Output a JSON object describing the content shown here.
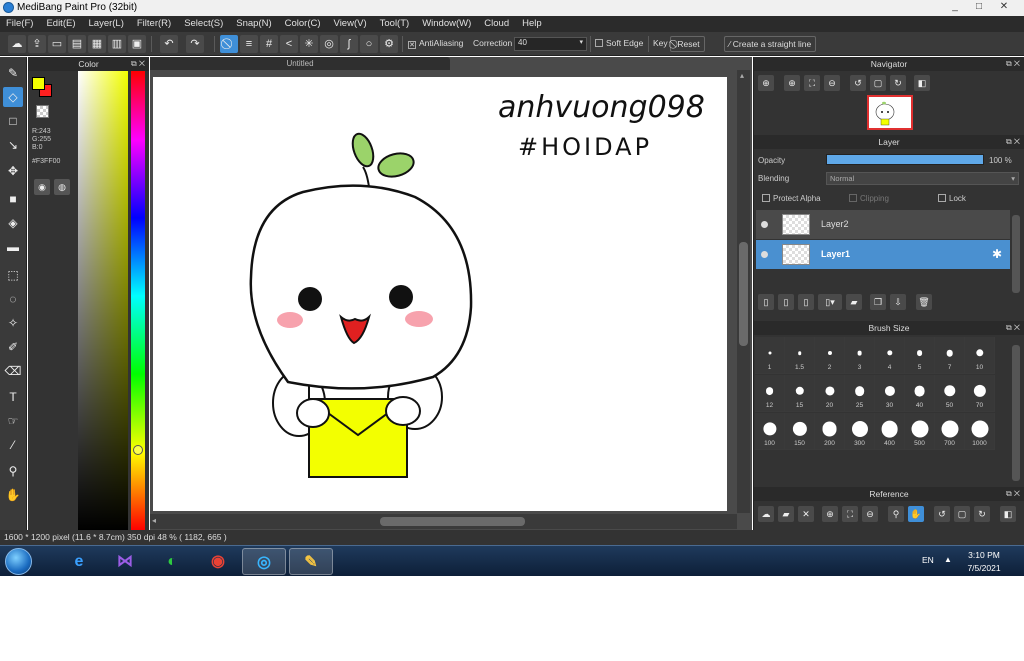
{
  "window": {
    "title": "MediBang Paint Pro (32bit)",
    "minimize": "_",
    "maximize": "□",
    "close": "✕"
  },
  "menu": [
    "File(F)",
    "Edit(E)",
    "Layer(L)",
    "Filter(R)",
    "Select(S)",
    "Snap(N)",
    "Color(C)",
    "View(V)",
    "Tool(T)",
    "Window(W)",
    "Cloud",
    "Help"
  ],
  "toolbar": {
    "antialiasing_label": "AntiAliasing",
    "correction_label": "Correction",
    "correction_value": "40",
    "soft_edge_label": "Soft Edge",
    "key_label": "Key",
    "reset_label": "Reset",
    "straight_line_label": "Create a straight line"
  },
  "color_panel": {
    "title": "Color",
    "foreground": "#F3FF00",
    "background": "#FF2020",
    "r": "R:243",
    "g": "G:255",
    "b": "B:0",
    "hex": "#F3FF00"
  },
  "canvas": {
    "tab_title": "Untitled",
    "handwriting_line1": "anhvuong098",
    "handwriting_line2": "#HOIDAP"
  },
  "navigator": {
    "title": "Navigator"
  },
  "layer_panel": {
    "title": "Layer",
    "opacity_label": "Opacity",
    "opacity_value": "100 %",
    "opacity_fraction": 1.0,
    "blending_label": "Blending",
    "blending_value": "Normal",
    "protect_alpha": "Protect Alpha",
    "clipping": "Clipping",
    "lock": "Lock",
    "layers": [
      {
        "name": "Layer2",
        "selected": false
      },
      {
        "name": "Layer1",
        "selected": true
      }
    ]
  },
  "brush_panel": {
    "title": "Brush Size",
    "sizes": [
      "1",
      "1.5",
      "2",
      "3",
      "4",
      "5",
      "7",
      "10",
      "12",
      "15",
      "20",
      "25",
      "30",
      "40",
      "50",
      "70",
      "100",
      "150",
      "200",
      "300",
      "400",
      "500",
      "700",
      "1000"
    ]
  },
  "reference_panel": {
    "title": "Reference"
  },
  "status": {
    "text": "1600 * 1200 pixel   (11.6 * 8.7cm)   350 dpi   48 %   ( 1182, 665 )"
  },
  "taskbar": {
    "language": "EN",
    "time": "3:10 PM",
    "date": "7/5/2021"
  },
  "colors": {
    "accent": "#3F8FD8",
    "panel": "#333333",
    "selected_layer": "#4A90D0"
  }
}
